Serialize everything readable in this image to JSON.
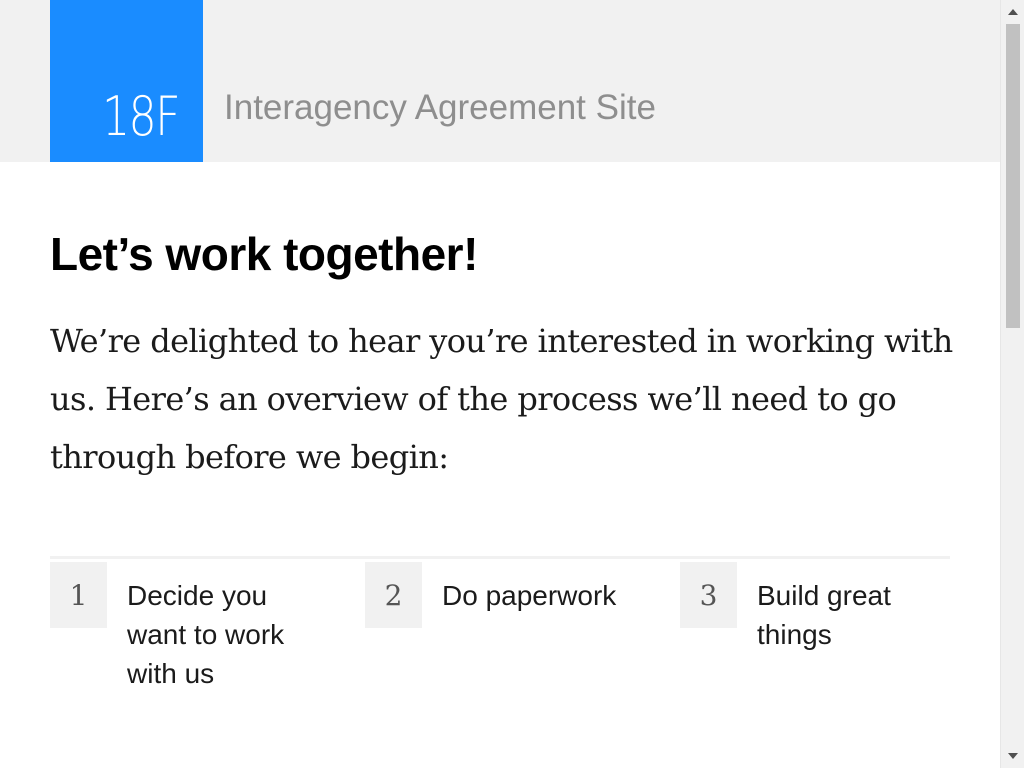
{
  "header": {
    "logo_text": "18F",
    "site_title": "Interagency Agreement Site"
  },
  "main": {
    "heading": "Let’s work together!",
    "intro": "We’re delighted to hear you’re interested in working with us. Here’s an overview of the process we’ll need to go through before we begin:"
  },
  "steps": [
    {
      "number": "1",
      "label": "Decide you want to work with us"
    },
    {
      "number": "2",
      "label": "Do paperwork"
    },
    {
      "number": "3",
      "label": "Build great things"
    }
  ],
  "colors": {
    "brand_blue": "#1a8cff",
    "header_bg": "#f1f1f1",
    "title_gray": "#8e8e8e"
  },
  "scrollbar": {
    "up_icon": "triangle-up",
    "down_icon": "triangle-down"
  }
}
